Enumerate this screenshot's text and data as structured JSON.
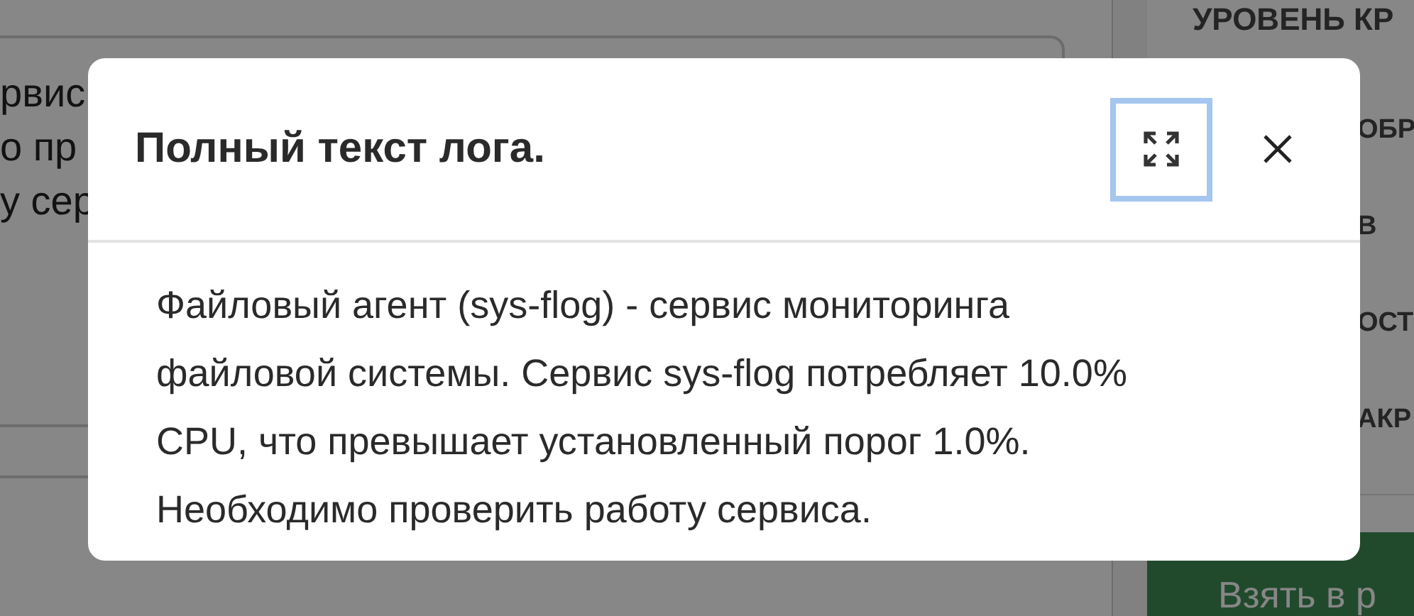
{
  "background": {
    "log_field_lines": [
      "рвис",
      "о пр",
      "у сер"
    ],
    "side_items": [
      "УРОВЕНЬ КР",
      "ОБР",
      "В",
      "ОСТ",
      "АКР"
    ],
    "button": "Взять в р"
  },
  "modal": {
    "title": "Полный текст лога.",
    "text": "Файловый агент (sys-flog) - сервис мониторинга файловой системы. Сервис sys-flog потребляет 10.0% CPU, что превышает установленный порог 1.0%. Необходимо проверить работу сервиса."
  }
}
